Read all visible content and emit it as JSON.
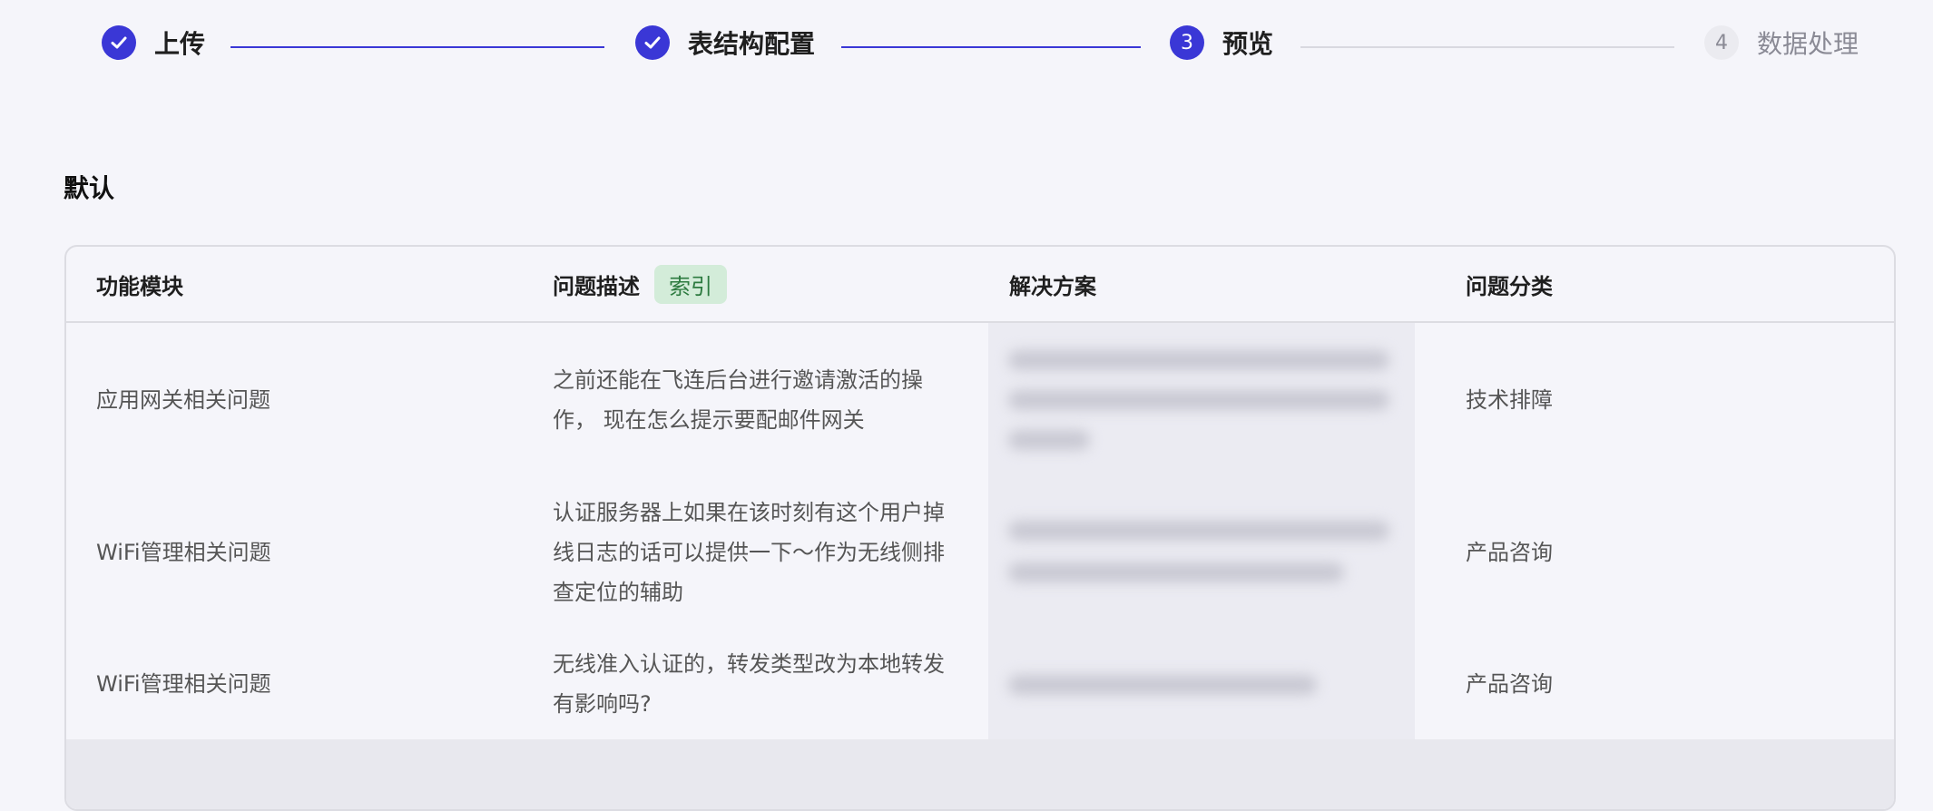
{
  "steps": [
    {
      "label": "上传",
      "state": "done",
      "number": ""
    },
    {
      "label": "表结构配置",
      "state": "done",
      "number": ""
    },
    {
      "label": "预览",
      "state": "active",
      "number": "3"
    },
    {
      "label": "数据处理",
      "state": "todo",
      "number": "4"
    }
  ],
  "section": {
    "title": "默认"
  },
  "table": {
    "columns": [
      "功能模块",
      "问题描述",
      "解决方案",
      "问题分类"
    ],
    "index_tag": "索引",
    "rows": [
      {
        "module": "应用网关相关问题",
        "description": "之前还能在飞连后台进行邀请激活的操作， 现在怎么提示要配邮件网关",
        "category": "技术排障"
      },
      {
        "module": "WiFi管理相关问题",
        "description": "认证服务器上如果在该时刻有这个用户掉线日志的话可以提供一下～作为无线侧排查定位的辅助",
        "category": "产品咨询"
      },
      {
        "module": "WiFi管理相关问题",
        "description": "无线准入认证的，转发类型改为本地转发有影响吗?",
        "category": "产品咨询"
      }
    ]
  },
  "colors": {
    "accent": "#3a37d6",
    "tag_bg": "#d3ecd9",
    "tag_text": "#2c7a3f"
  }
}
